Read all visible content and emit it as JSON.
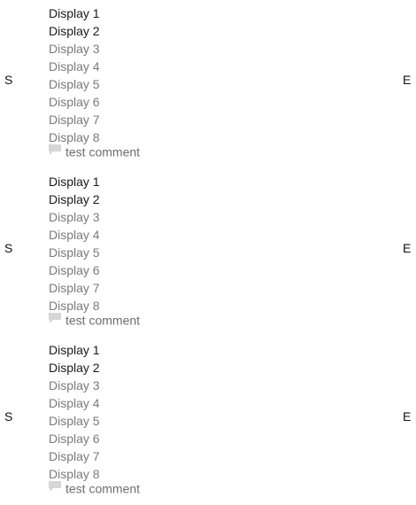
{
  "groups": [
    {
      "start_marker": "S",
      "end_marker": "E",
      "items": [
        {
          "label": "Display 1",
          "state": "active"
        },
        {
          "label": "Display 2",
          "state": "active"
        },
        {
          "label": "Display 3",
          "state": "muted"
        },
        {
          "label": "Display 4",
          "state": "muted"
        },
        {
          "label": "Display 5",
          "state": "muted"
        },
        {
          "label": "Display 6",
          "state": "muted"
        },
        {
          "label": "Display 7",
          "state": "muted"
        },
        {
          "label": "Display 8",
          "state": "muted"
        }
      ],
      "comment": {
        "text": "test comment",
        "icon": "comment-icon"
      }
    },
    {
      "start_marker": "S",
      "end_marker": "E",
      "items": [
        {
          "label": "Display 1",
          "state": "active"
        },
        {
          "label": "Display 2",
          "state": "active"
        },
        {
          "label": "Display 3",
          "state": "muted"
        },
        {
          "label": "Display 4",
          "state": "muted"
        },
        {
          "label": "Display 5",
          "state": "muted"
        },
        {
          "label": "Display 6",
          "state": "muted"
        },
        {
          "label": "Display 7",
          "state": "muted"
        },
        {
          "label": "Display 8",
          "state": "muted"
        }
      ],
      "comment": {
        "text": "test comment",
        "icon": "comment-icon"
      }
    },
    {
      "start_marker": "S",
      "end_marker": "E",
      "items": [
        {
          "label": "Display 1",
          "state": "active"
        },
        {
          "label": "Display 2",
          "state": "active"
        },
        {
          "label": "Display 3",
          "state": "muted"
        },
        {
          "label": "Display 4",
          "state": "muted"
        },
        {
          "label": "Display 5",
          "state": "muted"
        },
        {
          "label": "Display 6",
          "state": "muted"
        },
        {
          "label": "Display 7",
          "state": "muted"
        },
        {
          "label": "Display 8",
          "state": "muted"
        }
      ],
      "comment": {
        "text": "test comment",
        "icon": "comment-icon"
      }
    }
  ],
  "colors": {
    "active_text": "#1a1a1a",
    "muted_text": "#7a7a7a",
    "comment_icon": "#d6d6d6"
  }
}
